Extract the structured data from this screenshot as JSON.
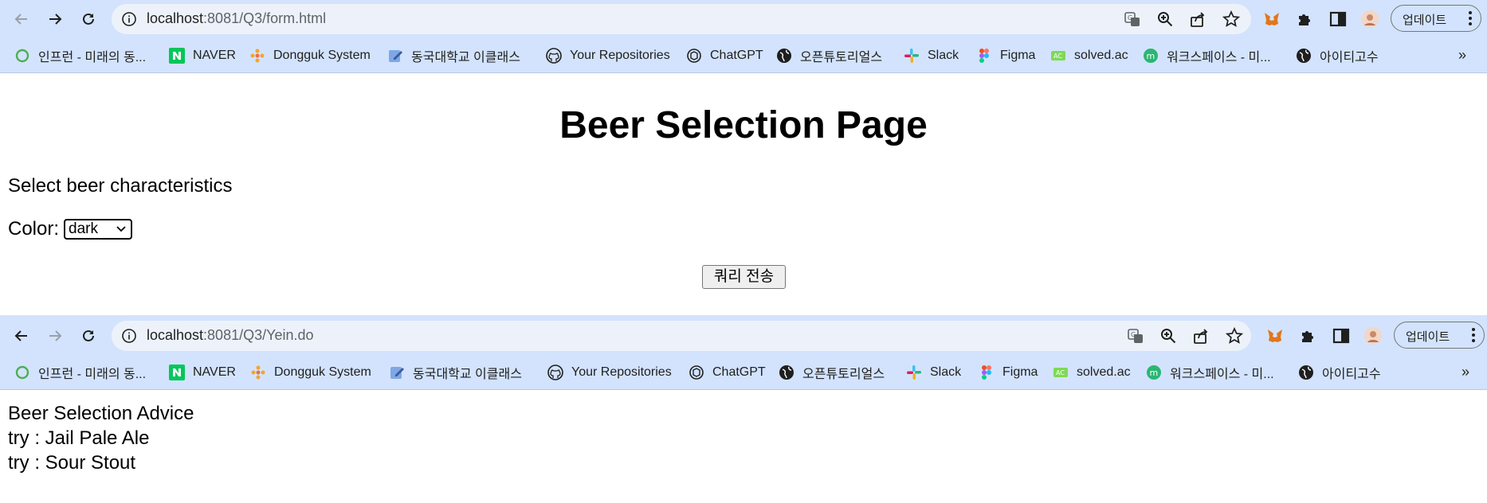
{
  "windows": [
    {
      "omnibox": {
        "url_host": "localhost",
        "url_path": ":8081/Q3/form.html"
      },
      "update_label": "업데이트"
    },
    {
      "omnibox": {
        "url_host": "localhost",
        "url_path": ":8081/Q3/Yein.do"
      },
      "update_label": "업데이트"
    }
  ],
  "bookmarks": [
    {
      "label": "인프런 - 미래의 동...",
      "icon": "inflearn-icon"
    },
    {
      "label": "NAVER",
      "icon": "naver-icon"
    },
    {
      "label": "Dongguk System",
      "icon": "dongguk-icon"
    },
    {
      "label": "동국대학교 이클래스",
      "icon": "eclass-icon"
    },
    {
      "label": "Your Repositories",
      "icon": "github-icon"
    },
    {
      "label": "ChatGPT",
      "icon": "chatgpt-icon"
    },
    {
      "label": "오픈튜토리얼스",
      "icon": "globe-icon"
    },
    {
      "label": "Slack",
      "icon": "slack-icon"
    },
    {
      "label": "Figma",
      "icon": "figma-icon"
    },
    {
      "label": "solved.ac",
      "icon": "solvedac-icon"
    },
    {
      "label": "워크스페이스 - 미...",
      "icon": "workspace-icon"
    },
    {
      "label": "아이티고수",
      "icon": "globe-icon"
    }
  ],
  "form_page": {
    "heading": "Beer Selection Page",
    "instruction": "Select beer characteristics",
    "color_label": "Color:",
    "color_selected": "dark",
    "submit_label": "쿼리 전송"
  },
  "result_page": {
    "heading": "Beer Selection Advice",
    "items": [
      "try : Jail Pale Ale",
      "try : Sour Stout"
    ]
  },
  "colors": {
    "toolbar_bg": "#d3e3fd",
    "omnibox_bg": "#edf2fa",
    "page_bg": "#ffffff"
  }
}
